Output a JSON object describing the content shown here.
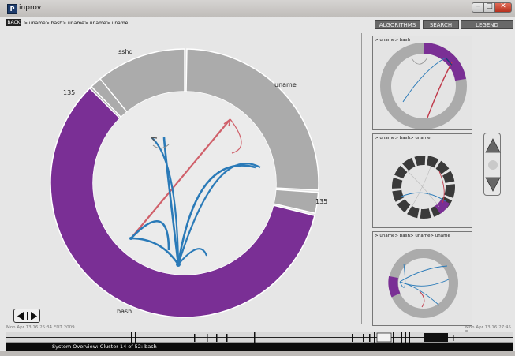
{
  "window": {
    "title": "inprov",
    "icon_letter": "P",
    "controls": {
      "minimize": "–",
      "maximize": "□",
      "close": "✕"
    }
  },
  "toolbar": {
    "back_label": "BACK",
    "breadcrumb": "> uname> bash> uname> uname> uname",
    "algorithms_label": "ALGORITHMS",
    "search_label": "SEARCH",
    "legend_label": "LEGEND"
  },
  "main_chart": {
    "segments": [
      {
        "label": "sshd",
        "color": "#ababab"
      },
      {
        "label": "uname",
        "color": "#ababab"
      },
      {
        "label": "135",
        "color": "#ababab"
      },
      {
        "label": "bash",
        "color": "#7a2f95"
      },
      {
        "label": "135",
        "color": "#ababab"
      }
    ],
    "labels": {
      "sshd": "sshd",
      "uname": "uname",
      "right_count": "135",
      "bash": "bash",
      "left_count": "135"
    },
    "colors": {
      "highlight": "#7a2f95",
      "inactive": "#ababab",
      "edge_blue": "#2a7ab8",
      "edge_red": "#d0606a"
    }
  },
  "thumbnails": [
    {
      "label": "> uname> bash"
    },
    {
      "label": "> uname> bash> uname"
    },
    {
      "label": "> uname> bash> uname> uname"
    }
  ],
  "navigation": {
    "up_icon": "up-arrow-icon",
    "down_icon": "down-arrow-icon",
    "center_icon": "circle-icon"
  },
  "playback": {
    "prev_icon": "triangle-left-icon",
    "next_icon": "triangle-right-icon"
  },
  "timeline": {
    "start_label": "Mon Apr 13 16:25:34 EDT 2009",
    "end_label": "Mon Apr 13 16:27:45 E"
  },
  "status": {
    "text": "System Overview: Cluster 14 of 52: bash"
  }
}
